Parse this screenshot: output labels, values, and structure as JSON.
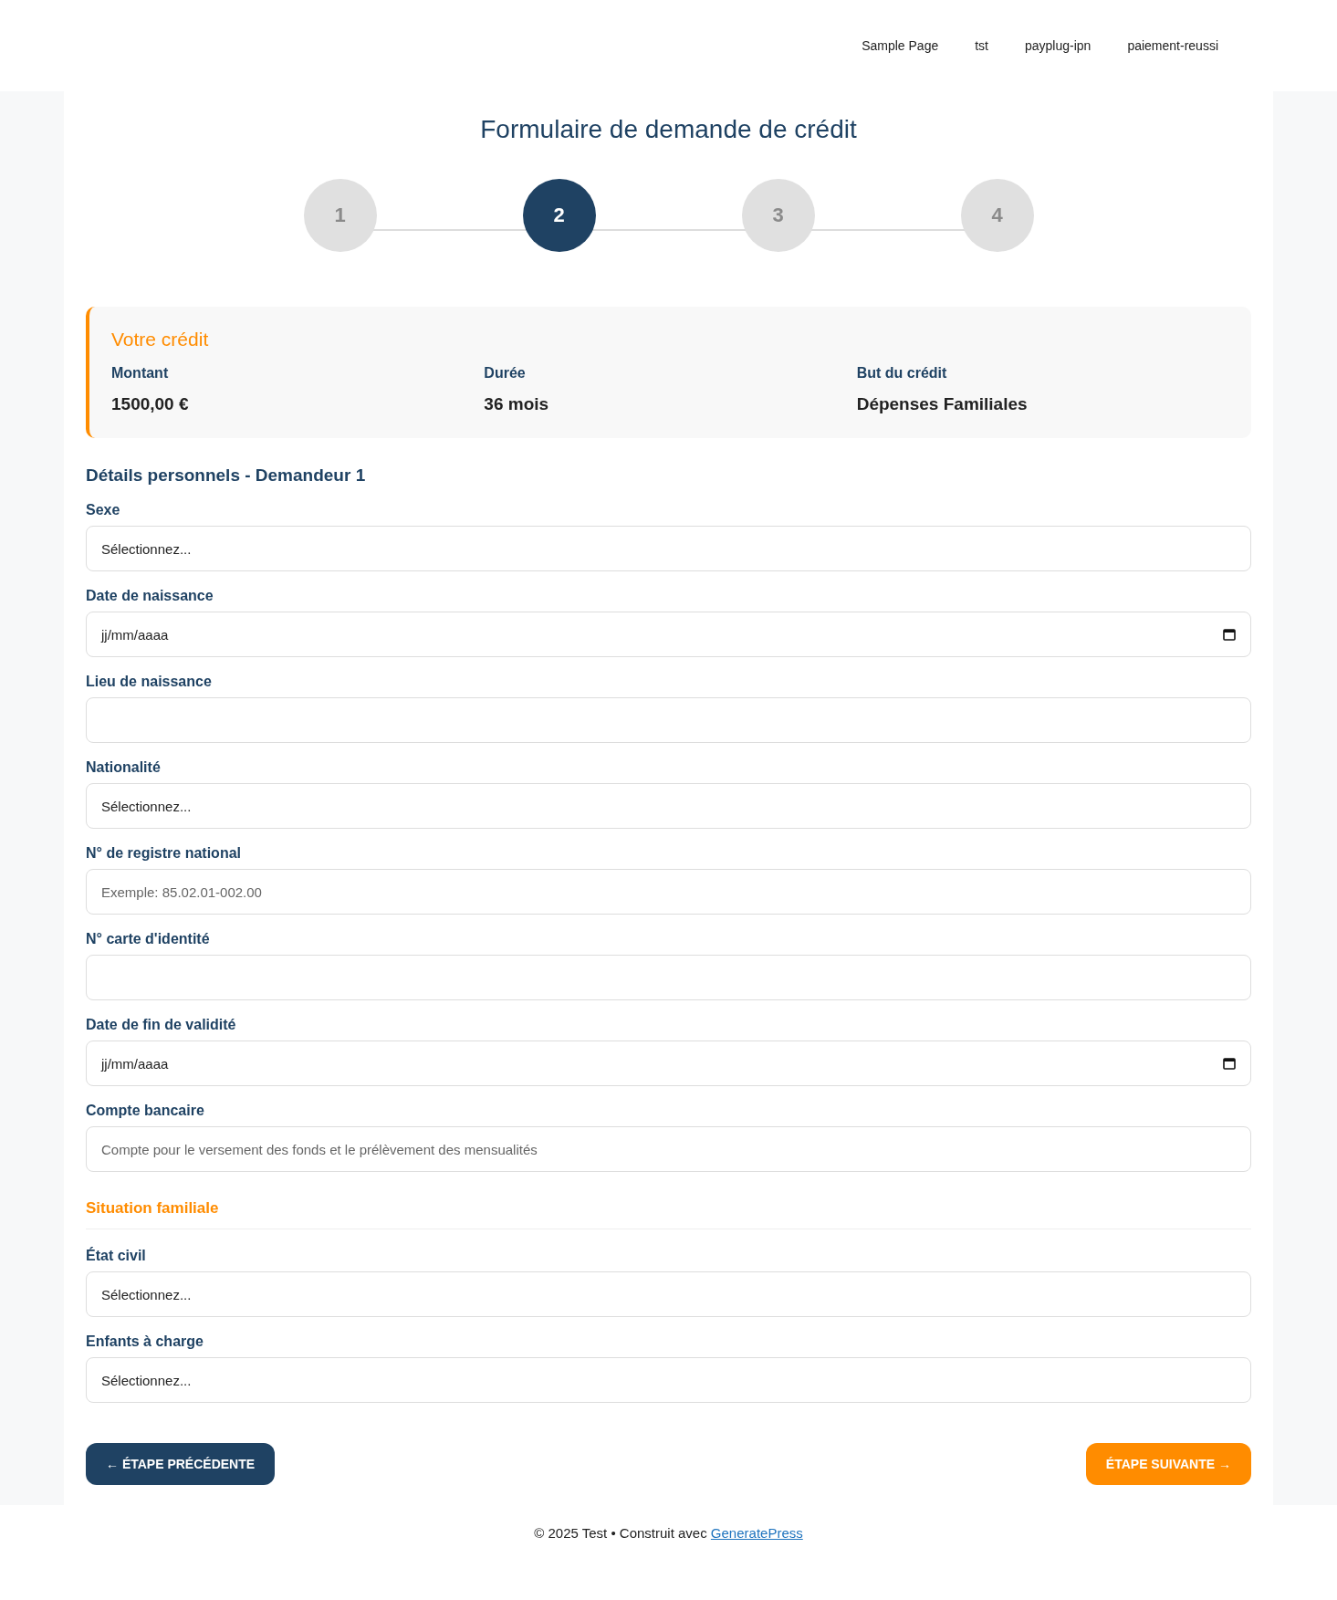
{
  "nav": [
    "Sample Page",
    "tst",
    "payplug-ipn",
    "paiement-reussi"
  ],
  "title": "Formulaire de demande de crédit",
  "steps": [
    {
      "label": "1",
      "selected": false
    },
    {
      "label": "2",
      "selected": true
    },
    {
      "label": "3",
      "selected": false
    },
    {
      "label": "4",
      "selected": false
    }
  ],
  "summary": {
    "title": "Votre crédit",
    "items": [
      {
        "label": "Montant",
        "value": "1500,00 €"
      },
      {
        "label": "Durée",
        "value": "36 mois"
      },
      {
        "label": "But du crédit",
        "value": "Dépenses Familiales"
      }
    ]
  },
  "sections": [
    {
      "kind": "plain",
      "title": "Détails personnels - Demandeur 1",
      "fields": [
        {
          "label": "Sexe",
          "kind": "select",
          "value": "Sélectionnez..."
        },
        {
          "label": "Date de naissance",
          "kind": "date",
          "value": "jj/mm/aaaa"
        },
        {
          "label": "Lieu de naissance",
          "kind": "text"
        },
        {
          "label": "Nationalité",
          "kind": "select",
          "value": "Sélectionnez..."
        },
        {
          "label": "N° de registre national",
          "kind": "text",
          "placeholder": "Exemple: 85.02.01-002.00"
        },
        {
          "label": "N° carte d'identité",
          "kind": "text"
        },
        {
          "label": "Date de fin de validité",
          "kind": "date",
          "value": "jj/mm/aaaa"
        },
        {
          "label": "Compte bancaire",
          "kind": "text",
          "placeholder": "Compte pour le versement des fonds et le prélèvement des mensualités"
        }
      ]
    },
    {
      "kind": "divided",
      "title": "Situation familiale",
      "fields": [
        {
          "label": "État civil",
          "kind": "select",
          "value": "Sélectionnez..."
        },
        {
          "label": "Enfants à charge",
          "kind": "select",
          "value": "Sélectionnez..."
        }
      ]
    }
  ],
  "buttons": [
    {
      "kind": "back",
      "label": "← ÉTAPE PRÉCÉDENTE"
    },
    {
      "kind": "next",
      "label": "ÉTAPE SUIVANTE →"
    }
  ],
  "footer": {
    "text": "© 2025 Test • Construit avec",
    "link": "GeneratePress"
  }
}
